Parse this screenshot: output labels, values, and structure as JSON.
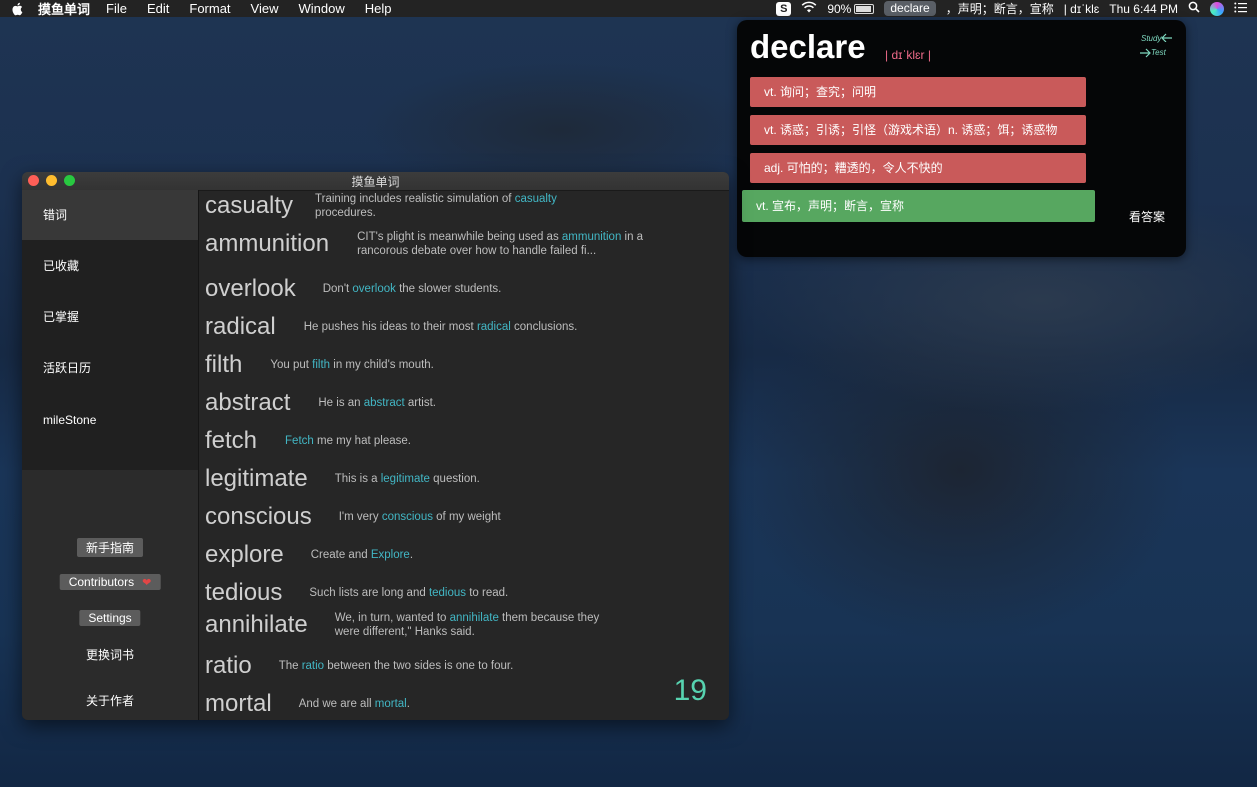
{
  "menubar": {
    "app_name": "摸鱼单词",
    "menus": [
      "File",
      "Edit",
      "Format",
      "View",
      "Window",
      "Help"
    ],
    "status": {
      "input_method": "S",
      "battery": "90%",
      "battery_level": 0.9,
      "current_word": "declare",
      "word_meaning": "，声明；断言，宣称",
      "phonetic": "| dɪˈklɛ",
      "clock": "Thu 6:44 PM"
    }
  },
  "card": {
    "word": "declare",
    "phonetic": "| dɪˈklɛr |",
    "mode_study": "Study",
    "mode_test": "Test",
    "options": [
      "vt. 询问；查究；问明",
      "vt. 诱惑；引诱；引怪（游戏术语）n. 诱惑；饵；诱惑物",
      "adj. 可怕的；糟透的，令人不快的",
      "vt. 宣布，声明；断言，宣称"
    ],
    "answer_button": "看答案",
    "colors": {
      "wrong": "#c95a5a",
      "correct": "#57a760"
    }
  },
  "window": {
    "title": "摸鱼单词",
    "sidebar": {
      "items": [
        "错词",
        "已收藏",
        "已掌握",
        "活跃日历",
        "mileStone"
      ],
      "guide_button": "新手指南",
      "contributors_button": "Contributors",
      "settings_button": "Settings",
      "change_book_link": "更换词书",
      "about_link": "关于作者"
    },
    "words": [
      {
        "word": "casualty",
        "before": "Training includes realistic simulation of ",
        "hl": "casualty",
        "after": " procedures."
      },
      {
        "word": "ammunition",
        "before": "CIT's plight is meanwhile being used as ",
        "hl": "ammunition",
        "after": " in a rancorous debate over how to handle failed fi..."
      },
      {
        "word": "overlook",
        "before": "Don't ",
        "hl": "overlook",
        "after": " the slower students."
      },
      {
        "word": "radical",
        "before": "He pushes his ideas to their most ",
        "hl": "radical",
        "after": " conclusions."
      },
      {
        "word": "filth",
        "before": "You put ",
        "hl": "filth",
        "after": " in my child's mouth."
      },
      {
        "word": "abstract",
        "before": "He is an ",
        "hl": "abstract",
        "after": " artist."
      },
      {
        "word": "fetch",
        "before": "",
        "hl": "Fetch",
        "after": " me my hat please."
      },
      {
        "word": "legitimate",
        "before": "This is a ",
        "hl": "legitimate",
        "after": " question."
      },
      {
        "word": "conscious",
        "before": "I'm very ",
        "hl": "conscious",
        "after": " of my weight"
      },
      {
        "word": "explore",
        "before": "Create and ",
        "hl": "Explore",
        "after": "."
      },
      {
        "word": "tedious",
        "before": "Such lists are long and ",
        "hl": "tedious",
        "after": " to read."
      },
      {
        "word": "annihilate",
        "before": "We, in turn, wanted to ",
        "hl": "annihilate",
        "after": " them because they were different,\" Hanks said."
      },
      {
        "word": "ratio",
        "before": "The ",
        "hl": "ratio",
        "after": " between the two sides is one to four."
      },
      {
        "word": "mortal",
        "before": "And we are all ",
        "hl": "mortal",
        "after": "."
      }
    ],
    "count": "19",
    "colors": {
      "highlight": "#42b6c4",
      "count": "#57d3b0"
    }
  }
}
